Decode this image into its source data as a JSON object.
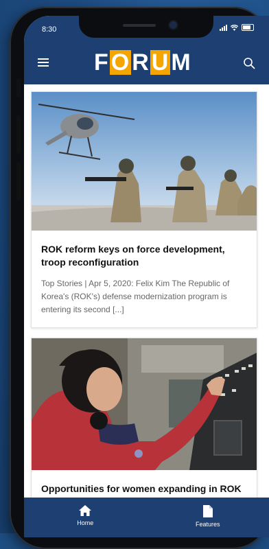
{
  "status_bar": {
    "time": "8:30"
  },
  "app_bar": {
    "logo_letters": [
      "F",
      "O",
      "R",
      "U",
      "M"
    ],
    "logo_boxed": [
      false,
      true,
      false,
      true,
      false
    ],
    "brand_color": "#1d3f72",
    "accent_color": "#f4a500"
  },
  "articles": [
    {
      "headline": "ROK reform keys on force development, troop reconfiguration",
      "summary": "Top Stories | Apr 5, 2020: Felix Kim The Republic of Korea's (ROK's) defense modernization program is entering its second [...]",
      "image": "soldiers-and-helicopter-photo"
    },
    {
      "headline": "Opportunities for women expanding in ROK military",
      "summary": "",
      "image": "woman-at-control-panel-photo"
    }
  ],
  "tab_bar": {
    "tabs": [
      {
        "label": "Home",
        "icon": "home-icon"
      },
      {
        "label": "Features",
        "icon": "document-icon"
      }
    ]
  }
}
